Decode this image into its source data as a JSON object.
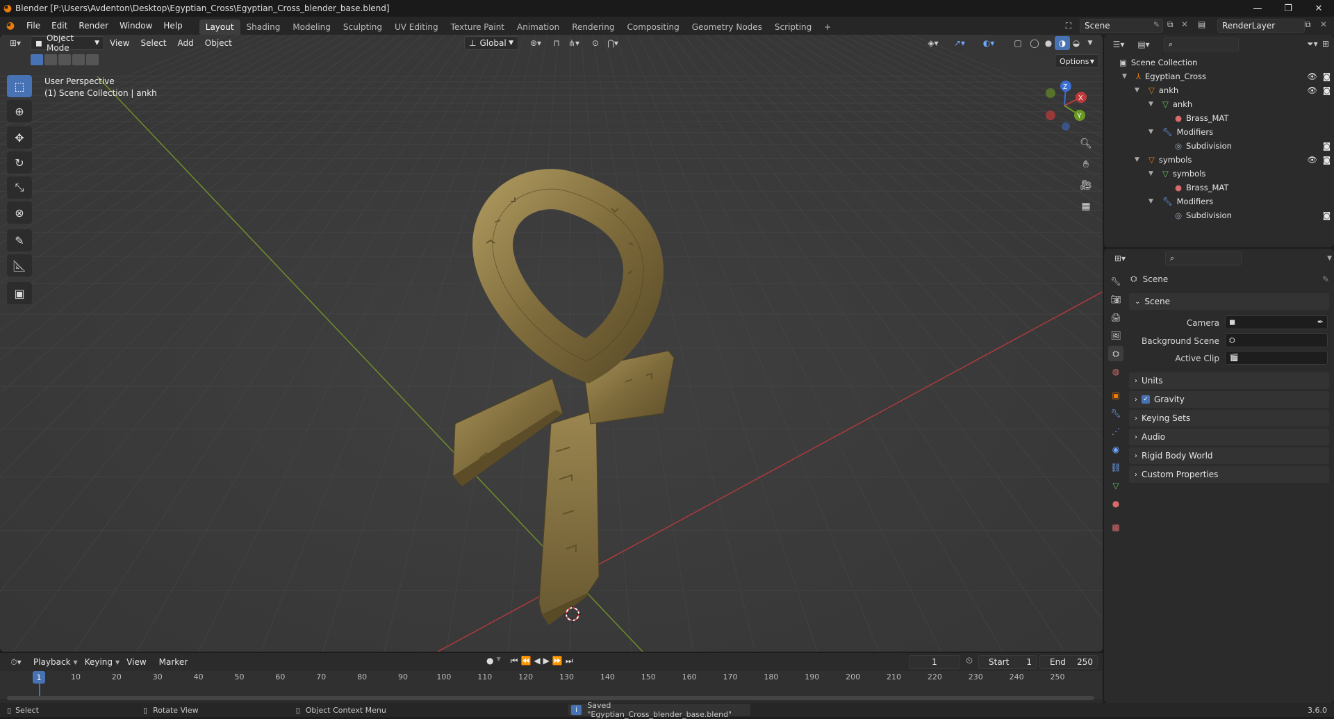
{
  "window": {
    "title": "Blender [P:\\Users\\Avdenton\\Desktop\\Egyptian_Cross\\Egyptian_Cross_blender_base.blend]",
    "min": "—",
    "max": "❐",
    "close": "✕"
  },
  "menus": [
    "File",
    "Edit",
    "Render",
    "Window",
    "Help"
  ],
  "workspaces": {
    "tabs": [
      "Layout",
      "Shading",
      "Modeling",
      "Sculpting",
      "UV Editing",
      "Texture Paint",
      "Animation",
      "Rendering",
      "Compositing",
      "Geometry Nodes",
      "Scripting"
    ],
    "active": "Layout",
    "add": "+"
  },
  "scene_selector": {
    "value": "Scene"
  },
  "view_layer_selector": {
    "value": "RenderLayer"
  },
  "viewport": {
    "mode": "Object Mode",
    "menus": [
      "View",
      "Select",
      "Add",
      "Object"
    ],
    "transform_orientation": "Global",
    "options_label": "Options",
    "info_line1": "User Perspective",
    "info_line2": "(1) Scene Collection | ankh",
    "gizmo": {
      "x": "X",
      "y": "Y",
      "z": "Z"
    }
  },
  "outliner": {
    "search_placeholder": "",
    "rows": [
      {
        "label": "Scene Collection"
      },
      {
        "label": "Egyptian_Cross"
      },
      {
        "label": "ankh"
      },
      {
        "label": "ankh"
      },
      {
        "label": "Brass_MAT"
      },
      {
        "label": "Modifiers"
      },
      {
        "label": "Subdivision"
      },
      {
        "label": "symbols"
      },
      {
        "label": "symbols"
      },
      {
        "label": "Brass_MAT"
      },
      {
        "label": "Modifiers"
      },
      {
        "label": "Subdivision"
      }
    ]
  },
  "properties": {
    "context_title": "Scene",
    "panel_scene": "Scene",
    "fields": {
      "camera": "Camera",
      "background_scene": "Background Scene",
      "active_clip": "Active Clip"
    },
    "subpanels": [
      "Units",
      "Gravity",
      "Keying Sets",
      "Audio",
      "Rigid Body World",
      "Custom Properties"
    ],
    "gravity_checked": true
  },
  "timeline": {
    "menus": [
      "Playback",
      "Keying",
      "View",
      "Marker"
    ],
    "current_frame": "1",
    "start_label": "Start",
    "start_value": "1",
    "end_label": "End",
    "end_value": "250",
    "ruler": [
      "1",
      "10",
      "20",
      "30",
      "40",
      "50",
      "60",
      "70",
      "80",
      "90",
      "100",
      "110",
      "120",
      "130",
      "140",
      "150",
      "160",
      "170",
      "180",
      "190",
      "200",
      "210",
      "220",
      "230",
      "240",
      "250"
    ]
  },
  "statusbar": {
    "select": "Select",
    "rotate": "Rotate View",
    "context_menu": "Object Context Menu",
    "message": "Saved \"Egyptian_Cross_blender_base.blend\"",
    "version": "3.6.0"
  },
  "colors": {
    "accent": "#4772b3",
    "axis_x": "#c0393b",
    "axis_y": "#6a9a23",
    "axis_z": "#3b6fd0",
    "brass": "#8c7a48",
    "object_orange": "#e87d0d"
  }
}
